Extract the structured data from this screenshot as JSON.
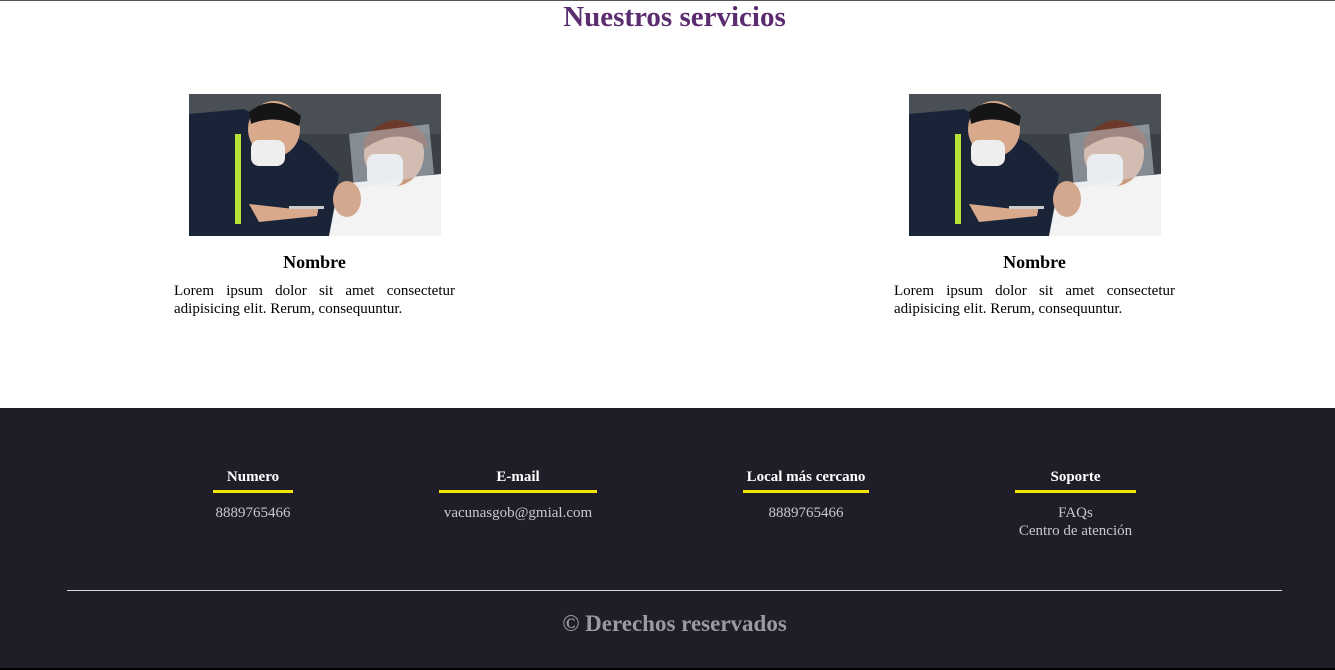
{
  "page": {
    "title": "Nuestros servicios"
  },
  "services": [
    {
      "image_alt": "Vacunación",
      "name": "Nombre",
      "description": "Lorem ipsum dolor sit amet consectetur adipisicing elit. Rerum, consequuntur."
    },
    {
      "image_alt": "Vacunación",
      "name": "Nombre",
      "description": "Lorem ipsum dolor sit amet consectetur adipisicing elit. Rerum, consequuntur."
    }
  ],
  "footer": {
    "columns": [
      {
        "title": "Numero",
        "lines": [
          "8889765466"
        ]
      },
      {
        "title": "E-mail",
        "lines": [
          "vacunasgob@gmial.com"
        ]
      },
      {
        "title": "Local más cercano",
        "lines": [
          "8889765466"
        ]
      },
      {
        "title": "Soporte",
        "lines": [
          "FAQs",
          "Centro de atención"
        ]
      }
    ],
    "copyright": "© Derechos reservados"
  },
  "colors": {
    "title": "#5b2c6f",
    "footer_bg": "#1e1d28",
    "accent_bar": "#f2e600"
  }
}
